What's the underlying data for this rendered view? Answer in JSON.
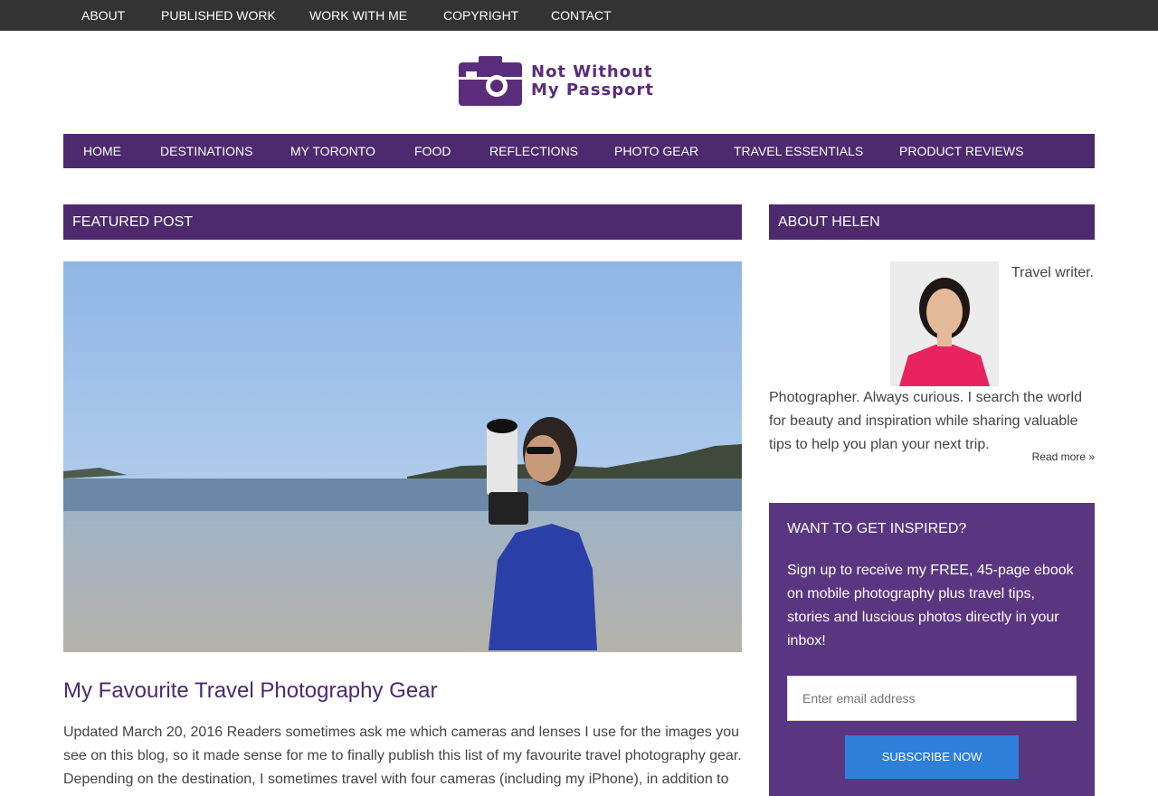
{
  "topnav": [
    "About",
    "Published Work",
    "Work With Me",
    "Copyright",
    "Contact"
  ],
  "logo": {
    "line1": "Not Without",
    "line2": "My Passport"
  },
  "mainnav": [
    "Home",
    "Destinations",
    "My Toronto",
    "Food",
    "Reflections",
    "Photo Gear",
    "Travel Essentials",
    "Product Reviews"
  ],
  "featured": {
    "heading": "Featured Post",
    "title": "My Favourite Travel Photography Gear",
    "excerpt": "Updated March 20, 2016 Readers sometimes ask me which cameras and lenses I use for the images you see on this blog, so it made sense for me to finally publish this list of my favourite travel photography gear. Depending on the destination, I sometimes travel with four cameras (including my iPhone), in addition to"
  },
  "about": {
    "heading": "About Helen",
    "text": "Travel writer. Photographer. Always curious. I search the world for beauty and inspiration while sharing valuable tips to help you plan your next trip.",
    "read_more": "Read more »"
  },
  "inspire": {
    "heading": "Want to Get Inspired?",
    "text": "Sign up to receive my FREE, 45-page ebook on mobile photography plus travel tips, stories and luscious photos directly in your inbox!",
    "email_placeholder": "Enter email address",
    "button": "Subscribe Now"
  },
  "colors": {
    "nav_purple": "#4d2a6e",
    "box_purple": "#5b3680",
    "button_blue": "#2f7fd8",
    "topbar": "#333333"
  }
}
